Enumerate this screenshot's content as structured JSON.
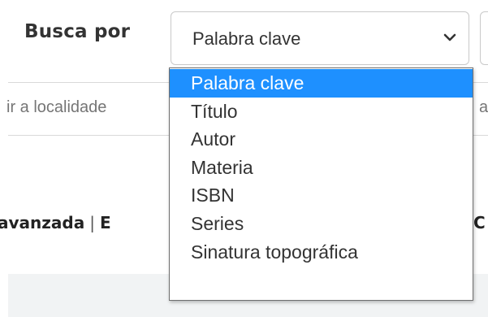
{
  "search": {
    "label": "Busca por",
    "selected_value": "Palabra clave",
    "chevron_icon": "chevron-down-icon",
    "options": [
      {
        "label": "Palabra clave",
        "selected": true
      },
      {
        "label": "Título",
        "selected": false
      },
      {
        "label": "Autor",
        "selected": false
      },
      {
        "label": "Materia",
        "selected": false
      },
      {
        "label": "ISBN",
        "selected": false
      },
      {
        "label": "Series",
        "selected": false
      },
      {
        "label": "Sinatura topográfica",
        "selected": false
      }
    ]
  },
  "location": {
    "placeholder_partial": "ir a localidade",
    "right_partial": "ar"
  },
  "links": {
    "advanced_partial": "avanzada",
    "separator": "|",
    "next_partial": "E",
    "right_partial": "C"
  },
  "colors": {
    "highlight": "#1e90ff",
    "text": "#333333",
    "panel": "#f1f3f4"
  }
}
